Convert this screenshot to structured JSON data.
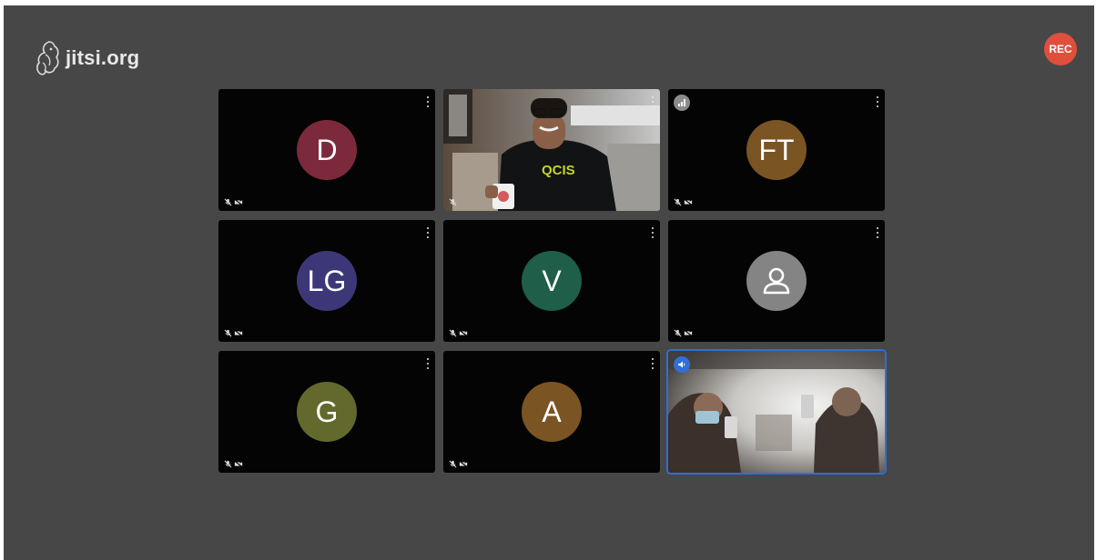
{
  "app": {
    "logo_text": "jitsi.org",
    "rec_label": "REC"
  },
  "colors": {
    "background": "#474747",
    "tile": "#040404",
    "recording": "#e04f3c",
    "active_speaker": "#2f6fd8"
  },
  "participants": [
    {
      "initials": "D",
      "avatar_color": "#7c2a3b",
      "type": "avatar",
      "mic_muted": true,
      "camera_off": true
    },
    {
      "initials": "",
      "type": "video",
      "video_subject": "person-with-mug",
      "mic_muted": true,
      "camera_off": false
    },
    {
      "initials": "FT",
      "avatar_color": "#7b5424",
      "type": "avatar",
      "mic_muted": true,
      "camera_off": true,
      "connection_indicator": "signal-icon"
    },
    {
      "initials": "LG",
      "avatar_color": "#3c3878",
      "type": "avatar",
      "mic_muted": true,
      "camera_off": true
    },
    {
      "initials": "V",
      "avatar_color": "#1f5e48",
      "type": "avatar",
      "mic_muted": true,
      "camera_off": true
    },
    {
      "initials": "",
      "avatar_color": "#848484",
      "type": "default-avatar",
      "icon": "person-icon",
      "mic_muted": true,
      "camera_off": true
    },
    {
      "initials": "G",
      "avatar_color": "#63692c",
      "type": "avatar",
      "mic_muted": true,
      "camera_off": true
    },
    {
      "initials": "A",
      "avatar_color": "#7b5424",
      "type": "avatar",
      "mic_muted": true,
      "camera_off": true
    },
    {
      "initials": "",
      "type": "video",
      "video_subject": "two-people-with-cans",
      "active_speaker": true,
      "mic_muted": false,
      "camera_off": false,
      "connection_indicator": "dominant-speaker-icon"
    }
  ]
}
